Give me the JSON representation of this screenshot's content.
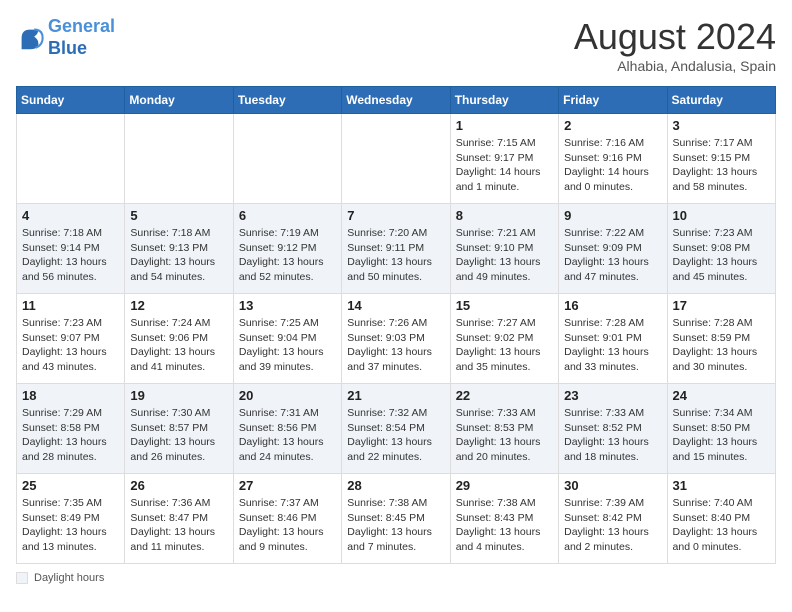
{
  "header": {
    "logo_line1": "General",
    "logo_line2": "Blue",
    "month_year": "August 2024",
    "location": "Alhabia, Andalusia, Spain"
  },
  "days_of_week": [
    "Sunday",
    "Monday",
    "Tuesday",
    "Wednesday",
    "Thursday",
    "Friday",
    "Saturday"
  ],
  "weeks": [
    [
      {
        "day": "",
        "info": ""
      },
      {
        "day": "",
        "info": ""
      },
      {
        "day": "",
        "info": ""
      },
      {
        "day": "",
        "info": ""
      },
      {
        "day": "1",
        "info": "Sunrise: 7:15 AM\nSunset: 9:17 PM\nDaylight: 14 hours\nand 1 minute."
      },
      {
        "day": "2",
        "info": "Sunrise: 7:16 AM\nSunset: 9:16 PM\nDaylight: 14 hours\nand 0 minutes."
      },
      {
        "day": "3",
        "info": "Sunrise: 7:17 AM\nSunset: 9:15 PM\nDaylight: 13 hours\nand 58 minutes."
      }
    ],
    [
      {
        "day": "4",
        "info": "Sunrise: 7:18 AM\nSunset: 9:14 PM\nDaylight: 13 hours\nand 56 minutes."
      },
      {
        "day": "5",
        "info": "Sunrise: 7:18 AM\nSunset: 9:13 PM\nDaylight: 13 hours\nand 54 minutes."
      },
      {
        "day": "6",
        "info": "Sunrise: 7:19 AM\nSunset: 9:12 PM\nDaylight: 13 hours\nand 52 minutes."
      },
      {
        "day": "7",
        "info": "Sunrise: 7:20 AM\nSunset: 9:11 PM\nDaylight: 13 hours\nand 50 minutes."
      },
      {
        "day": "8",
        "info": "Sunrise: 7:21 AM\nSunset: 9:10 PM\nDaylight: 13 hours\nand 49 minutes."
      },
      {
        "day": "9",
        "info": "Sunrise: 7:22 AM\nSunset: 9:09 PM\nDaylight: 13 hours\nand 47 minutes."
      },
      {
        "day": "10",
        "info": "Sunrise: 7:23 AM\nSunset: 9:08 PM\nDaylight: 13 hours\nand 45 minutes."
      }
    ],
    [
      {
        "day": "11",
        "info": "Sunrise: 7:23 AM\nSunset: 9:07 PM\nDaylight: 13 hours\nand 43 minutes."
      },
      {
        "day": "12",
        "info": "Sunrise: 7:24 AM\nSunset: 9:06 PM\nDaylight: 13 hours\nand 41 minutes."
      },
      {
        "day": "13",
        "info": "Sunrise: 7:25 AM\nSunset: 9:04 PM\nDaylight: 13 hours\nand 39 minutes."
      },
      {
        "day": "14",
        "info": "Sunrise: 7:26 AM\nSunset: 9:03 PM\nDaylight: 13 hours\nand 37 minutes."
      },
      {
        "day": "15",
        "info": "Sunrise: 7:27 AM\nSunset: 9:02 PM\nDaylight: 13 hours\nand 35 minutes."
      },
      {
        "day": "16",
        "info": "Sunrise: 7:28 AM\nSunset: 9:01 PM\nDaylight: 13 hours\nand 33 minutes."
      },
      {
        "day": "17",
        "info": "Sunrise: 7:28 AM\nSunset: 8:59 PM\nDaylight: 13 hours\nand 30 minutes."
      }
    ],
    [
      {
        "day": "18",
        "info": "Sunrise: 7:29 AM\nSunset: 8:58 PM\nDaylight: 13 hours\nand 28 minutes."
      },
      {
        "day": "19",
        "info": "Sunrise: 7:30 AM\nSunset: 8:57 PM\nDaylight: 13 hours\nand 26 minutes."
      },
      {
        "day": "20",
        "info": "Sunrise: 7:31 AM\nSunset: 8:56 PM\nDaylight: 13 hours\nand 24 minutes."
      },
      {
        "day": "21",
        "info": "Sunrise: 7:32 AM\nSunset: 8:54 PM\nDaylight: 13 hours\nand 22 minutes."
      },
      {
        "day": "22",
        "info": "Sunrise: 7:33 AM\nSunset: 8:53 PM\nDaylight: 13 hours\nand 20 minutes."
      },
      {
        "day": "23",
        "info": "Sunrise: 7:33 AM\nSunset: 8:52 PM\nDaylight: 13 hours\nand 18 minutes."
      },
      {
        "day": "24",
        "info": "Sunrise: 7:34 AM\nSunset: 8:50 PM\nDaylight: 13 hours\nand 15 minutes."
      }
    ],
    [
      {
        "day": "25",
        "info": "Sunrise: 7:35 AM\nSunset: 8:49 PM\nDaylight: 13 hours\nand 13 minutes."
      },
      {
        "day": "26",
        "info": "Sunrise: 7:36 AM\nSunset: 8:47 PM\nDaylight: 13 hours\nand 11 minutes."
      },
      {
        "day": "27",
        "info": "Sunrise: 7:37 AM\nSunset: 8:46 PM\nDaylight: 13 hours\nand 9 minutes."
      },
      {
        "day": "28",
        "info": "Sunrise: 7:38 AM\nSunset: 8:45 PM\nDaylight: 13 hours\nand 7 minutes."
      },
      {
        "day": "29",
        "info": "Sunrise: 7:38 AM\nSunset: 8:43 PM\nDaylight: 13 hours\nand 4 minutes."
      },
      {
        "day": "30",
        "info": "Sunrise: 7:39 AM\nSunset: 8:42 PM\nDaylight: 13 hours\nand 2 minutes."
      },
      {
        "day": "31",
        "info": "Sunrise: 7:40 AM\nSunset: 8:40 PM\nDaylight: 13 hours\nand 0 minutes."
      }
    ]
  ],
  "footer": {
    "note": "Daylight hours"
  }
}
